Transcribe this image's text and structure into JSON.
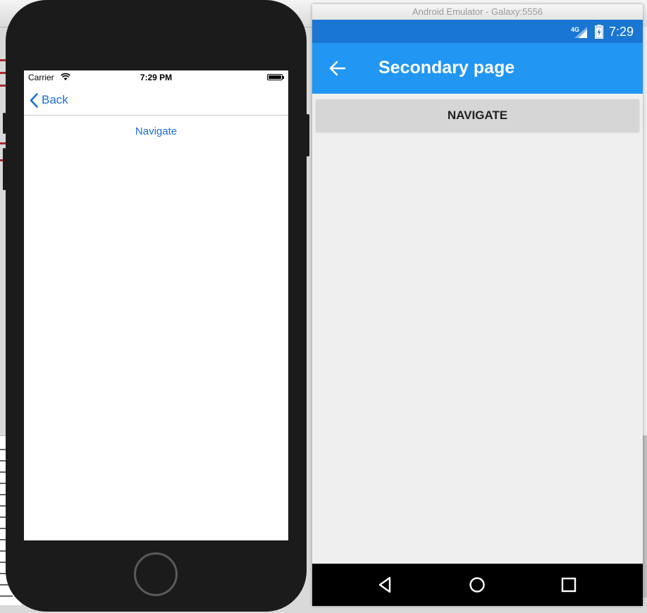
{
  "ios_simulator": {
    "status": {
      "carrier": "Carrier",
      "time": "7:29 PM"
    },
    "navbar": {
      "back_label": "Back"
    },
    "content": {
      "navigate_label": "Navigate"
    },
    "colors": {
      "tint": "#1c6fd6",
      "frame": "#1b1b1b"
    }
  },
  "android_emulator": {
    "window_title": "Android Emulator - Galaxy:5556",
    "status": {
      "network": "4G",
      "time": "7:29"
    },
    "appbar": {
      "title": "Secondary page"
    },
    "content": {
      "navigate_label": "NAVIGATE"
    },
    "colors": {
      "status_bar": "#1976d2",
      "app_bar": "#2196f3",
      "button": "#d6d6d6"
    },
    "nav_buttons": [
      "back-triangle-icon",
      "home-circle-icon",
      "recents-square-icon"
    ]
  }
}
